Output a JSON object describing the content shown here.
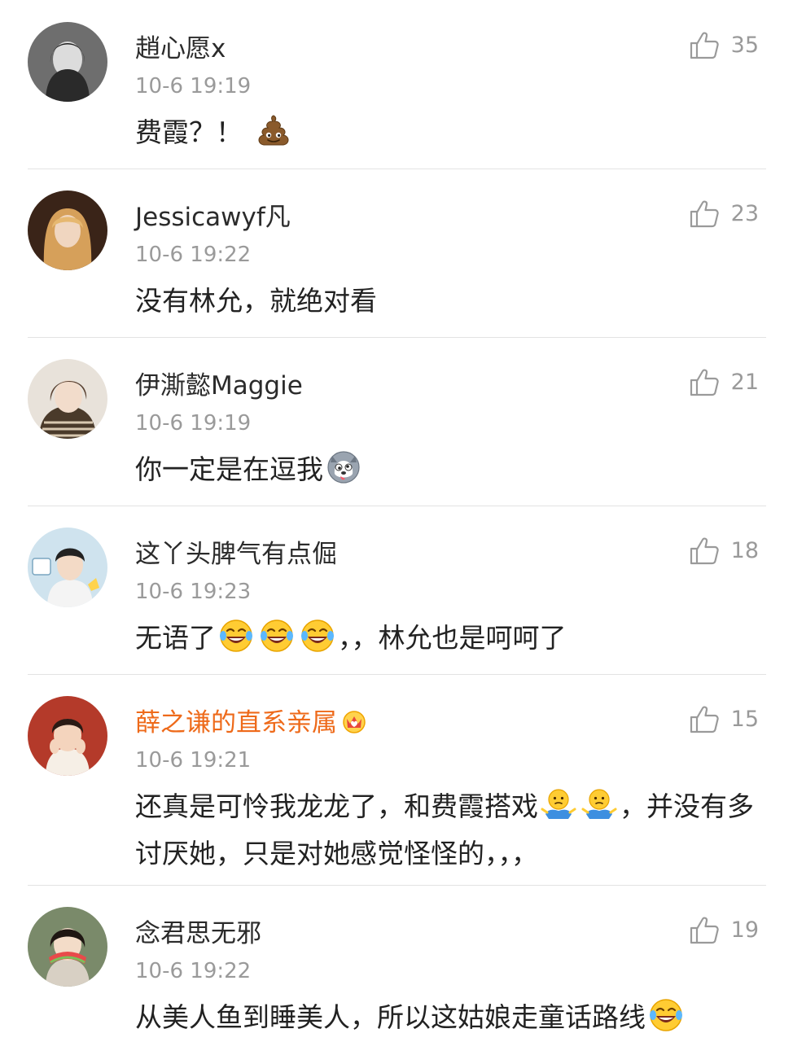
{
  "comments": [
    {
      "username": "趙心愿x",
      "time": "10-6 19:19",
      "likes": "35",
      "text": "费霞？！",
      "emojis": [
        "poop-emoji"
      ],
      "avatar_color": "#6e6e6e"
    },
    {
      "username": "Jessicawyf凡",
      "time": "10-6 19:22",
      "likes": "23",
      "text": "没有林允，就绝对看",
      "avatar_color": "#8a5a3a"
    },
    {
      "username": "伊澌懿Maggie",
      "time": "10-6 19:19",
      "likes": "21",
      "text": "你一定是在逗我",
      "emojis": [
        "husky-emoji"
      ],
      "avatar_color": "#c9b8a4"
    },
    {
      "username": "这丫头脾气有点倔",
      "time": "10-6 19:23",
      "likes": "18",
      "text_before": "无语了",
      "text_after": "，，林允也是呵呵了",
      "emojis": [
        "laugh-cry-emoji",
        "laugh-cry-emoji",
        "laugh-cry-emoji"
      ],
      "avatar_color": "#cfe3ee"
    },
    {
      "username": "薛之谦的直系亲属",
      "username_color": "#ee6a1a",
      "badge": "crown-icon",
      "time": "10-6 19:21",
      "likes": "15",
      "text_before": "还真是可怜我龙龙了，和费霞搭戏",
      "text_after": "，并没有多讨厌她，只是对她感觉怪怪的，，，",
      "emojis": [
        "shrug-emoji",
        "shrug-emoji"
      ],
      "avatar_color": "#b43a2a"
    },
    {
      "username": "念君思无邪",
      "time": "10-6 19:22",
      "likes": "19",
      "text": "从美人鱼到睡美人，所以这姑娘走童话路线",
      "emojis": [
        "laugh-cry-emoji"
      ],
      "avatar_color": "#7a8a6a"
    }
  ],
  "colors": {
    "vip_name": "#ee6a1a",
    "meta_gray": "#9a9a9a",
    "divider": "#e3e3e3"
  }
}
